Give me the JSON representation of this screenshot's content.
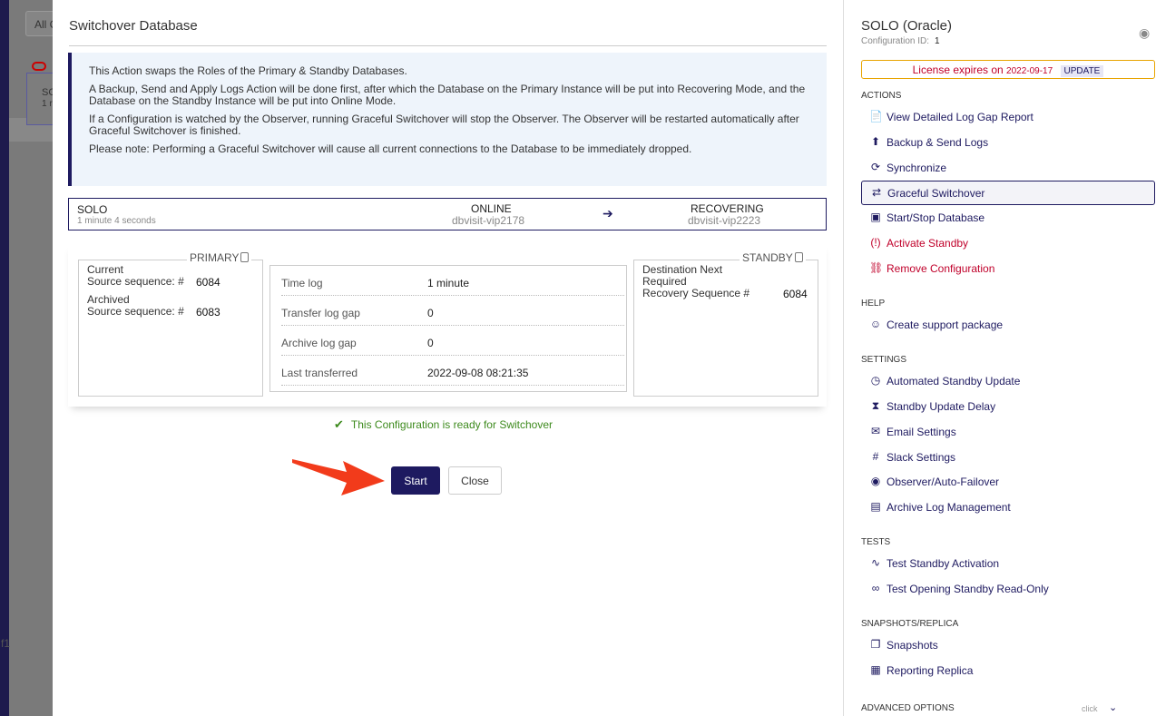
{
  "background": {
    "tab_label": "All C",
    "card_text": "SC",
    "card_sub": "1 r",
    "side_char": "f1"
  },
  "modal": {
    "title": "Switchover Database",
    "info": [
      "This Action swaps the Roles of the Primary & Standby Databases.",
      "A Backup, Send and Apply Logs Action will be done first, after which the Database on the Primary Instance will be put into Recovering Mode, and the Database on the Standby Instance will be put into Online Mode.",
      "If a Configuration is watched by the Observer, running Graceful Switchover will stop the Observer. The Observer will be restarted automatically after Graceful Switchover is finished.",
      "Please note: Performing a Graceful Switchover will cause all current connections to the Database to be immediately dropped."
    ],
    "route": {
      "name": "SOLO",
      "time": "1 minute 4 seconds",
      "from_state": "ONLINE",
      "from_host": "dbvisit-vip2178",
      "arrow": "➔",
      "to_state": "RECOVERING",
      "to_host": "dbvisit-vip2223"
    },
    "primary": {
      "heading": "PRIMARY",
      "current_label_1": "Current",
      "current_label_2": "Source sequence: #",
      "current_value": "6084",
      "archived_label_1": "Archived",
      "archived_label_2": "Source sequence: #",
      "archived_value": "6083"
    },
    "middle": [
      {
        "label": "Time log",
        "value": "1 minute"
      },
      {
        "label": "Transfer log gap",
        "value": "0"
      },
      {
        "label": "Archive log gap",
        "value": "0"
      },
      {
        "label": "Last transferred",
        "value": "2022-09-08 08:21:35"
      }
    ],
    "standby": {
      "heading": "STANDBY",
      "line1": "Destination Next",
      "line2": "Required",
      "line3": "Recovery Sequence #",
      "value": "6084"
    },
    "ready_text": "This Configuration is ready for Switchover",
    "ready_icon": "✔",
    "start_label": "Start",
    "close_label": "Close"
  },
  "sidebar": {
    "title": "SOLO (Oracle)",
    "config_label": "Configuration ID:",
    "config_id": "1",
    "license_text": "License expires on",
    "license_date": "2022-09-17",
    "license_update": "UPDATE",
    "sections": {
      "actions": "ACTIONS",
      "help": "HELP",
      "settings": "SETTINGS",
      "tests": "TESTS",
      "snapshots": "SNAPSHOTS/REPLICA",
      "advanced": "ADVANCED OPTIONS"
    },
    "advanced_hint": "click",
    "actions": [
      {
        "label": "View Detailed Log Gap Report",
        "icon": "📄"
      },
      {
        "label": "Backup & Send Logs",
        "icon": "⬆"
      },
      {
        "label": "Synchronize",
        "icon": "⟳"
      },
      {
        "label": "Graceful Switchover",
        "icon": "⇄"
      },
      {
        "label": "Start/Stop Database",
        "icon": "▣"
      },
      {
        "label": "Activate Standby",
        "icon": "(!)"
      },
      {
        "label": "Remove Configuration",
        "icon": "⛓"
      }
    ],
    "help": [
      {
        "label": "Create support package",
        "icon": "☺"
      }
    ],
    "settings": [
      {
        "label": "Automated Standby Update",
        "icon": "◷"
      },
      {
        "label": "Standby Update Delay",
        "icon": "⧗"
      },
      {
        "label": "Email Settings",
        "icon": "✉"
      },
      {
        "label": "Slack Settings",
        "icon": "#"
      },
      {
        "label": "Observer/Auto-Failover",
        "icon": "◉"
      },
      {
        "label": "Archive Log Management",
        "icon": "▤"
      }
    ],
    "tests": [
      {
        "label": "Test Standby Activation",
        "icon": "∿"
      },
      {
        "label": "Test Opening Standby Read-Only",
        "icon": "∞"
      }
    ],
    "snapshots": [
      {
        "label": "Snapshots",
        "icon": "❐"
      },
      {
        "label": "Reporting Replica",
        "icon": "▦"
      }
    ]
  }
}
